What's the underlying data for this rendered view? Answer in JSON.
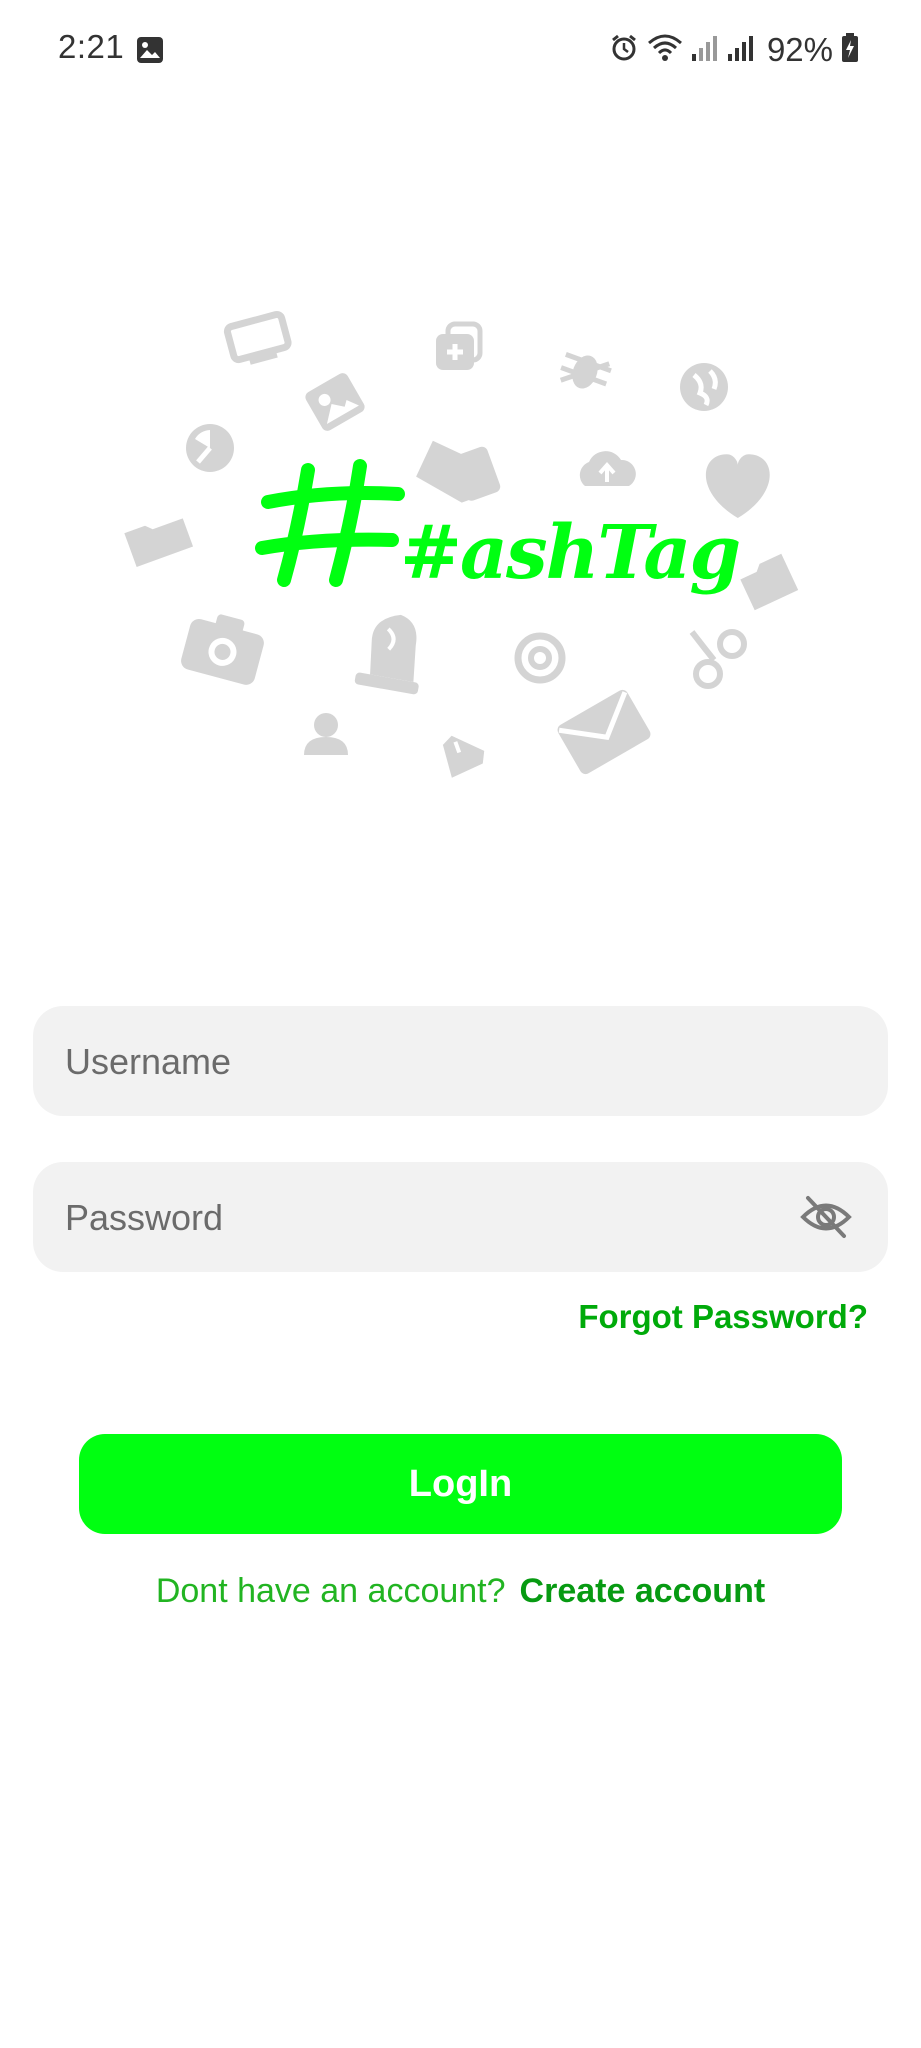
{
  "status_bar": {
    "time": "2:21",
    "battery": "92%",
    "icons": [
      "gallery-icon",
      "alarm-icon",
      "wifi-icon",
      "signal-icon",
      "signal-icon",
      "battery-charging-icon"
    ]
  },
  "logo": {
    "text": "#ashTag",
    "color": "#00ff11",
    "background_icons": [
      "monitor-icon",
      "medkit-icon",
      "bug-icon",
      "globe-icon",
      "photo-icon",
      "pie-icon",
      "arrow-icon",
      "cloud-upload-icon",
      "heart-icon",
      "folder-icon",
      "tag-icon",
      "camera-icon",
      "chess-knight-icon",
      "spiral-icon",
      "cyclist-icon",
      "user-icon",
      "diamond-icon",
      "envelope-icon"
    ]
  },
  "form": {
    "username_placeholder": "Username",
    "password_placeholder": "Password",
    "forgot_password": "Forgot Password?",
    "login_button": "LogIn",
    "signup_prompt": "Dont have an account?",
    "create_account": "Create account"
  },
  "colors": {
    "accent": "#00ff11",
    "link": "#00aa0a",
    "field_bg": "#f2f2f2"
  }
}
